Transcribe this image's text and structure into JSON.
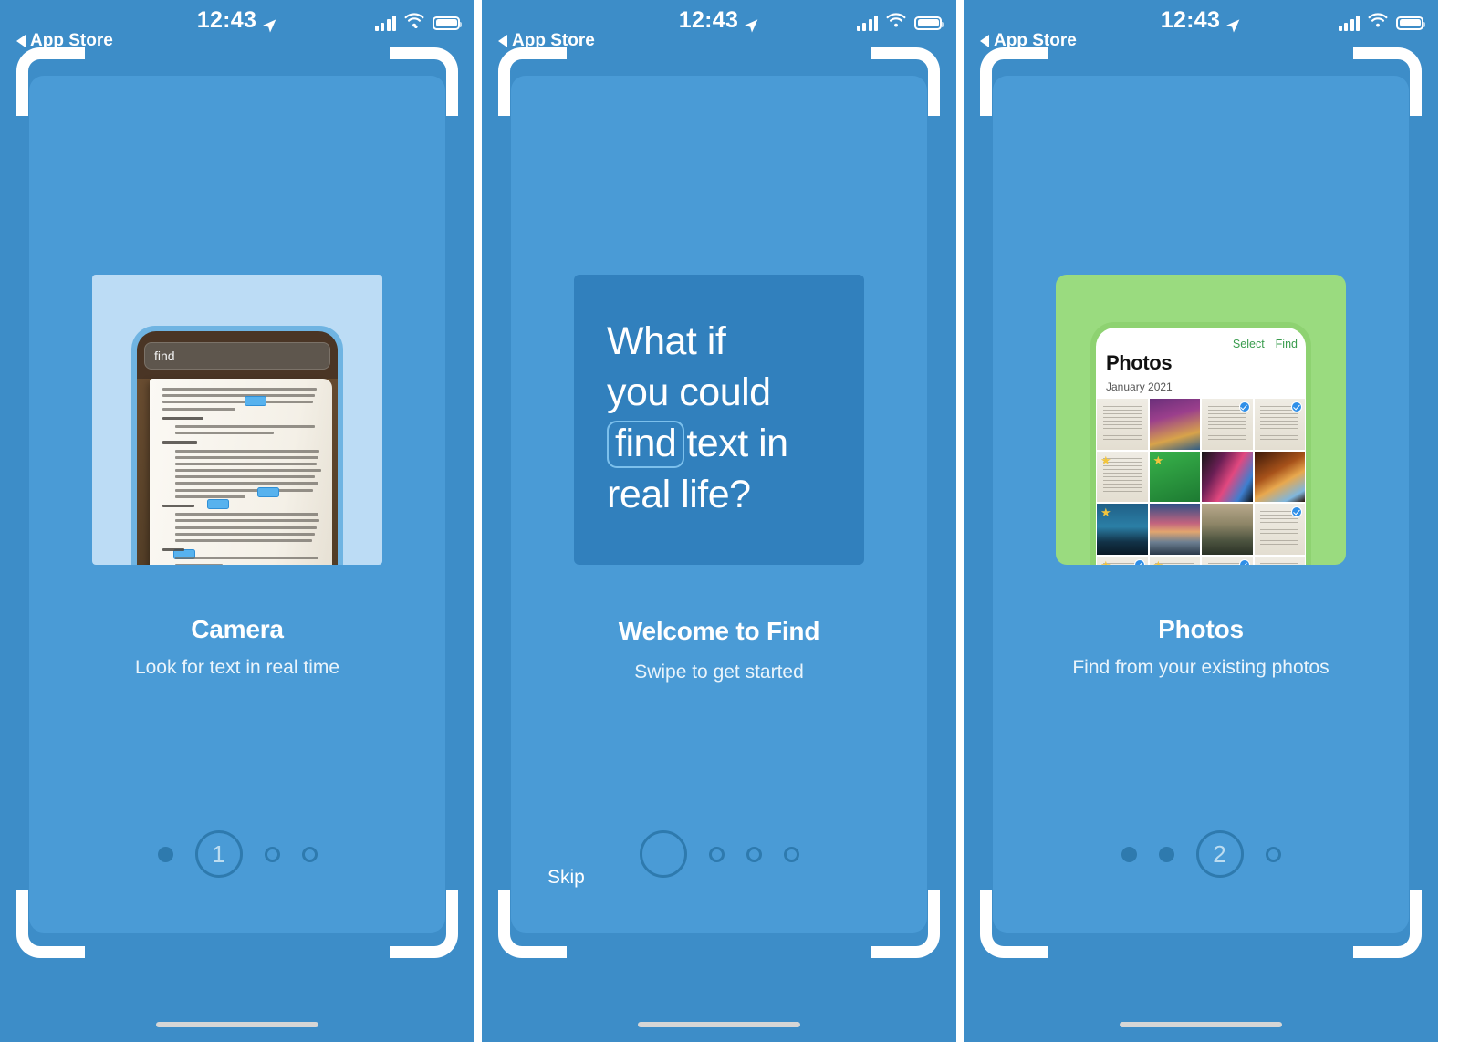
{
  "meta": {
    "accent_blue": "#4a9bd6",
    "panel_bg": "#3d8dc8",
    "dot_color": "#2e7aae",
    "quote_card_bg": "#3180bd",
    "photos_green": "#9adb7f",
    "camera_blue": "#bcdcf5"
  },
  "status_bar": {
    "time": "12:43",
    "back_label": "App Store",
    "location_icon": "location-arrow-icon",
    "signal_icon": "cellular-signal-icon",
    "wifi_icon": "wifi-icon",
    "battery_icon": "battery-icon"
  },
  "panels": [
    {
      "id": "camera",
      "caption_title": "Camera",
      "caption_subtitle": "Look for text in real time",
      "hero": {
        "kind": "phone-scanning-book",
        "search_value": "find",
        "backdrop_color": "#bcdcf5"
      },
      "pager": {
        "items": [
          {
            "type": "filled"
          },
          {
            "type": "current",
            "label": "1"
          },
          {
            "type": "hollow"
          },
          {
            "type": "hollow"
          }
        ]
      },
      "skip_label": null
    },
    {
      "id": "welcome",
      "caption_title": "Welcome to Find",
      "caption_subtitle": "Swipe to get started",
      "hero": {
        "kind": "quote-card",
        "backdrop_color": "#3180bd",
        "lines": [
          "What if",
          "you could",
          "",
          "real life?"
        ],
        "line3_pre": "",
        "highlight_word": "find",
        "line3_post": "text in"
      },
      "pager": {
        "items": [
          {
            "type": "current",
            "label": ""
          },
          {
            "type": "hollow"
          },
          {
            "type": "hollow"
          },
          {
            "type": "hollow"
          }
        ]
      },
      "skip_label": "Skip"
    },
    {
      "id": "photos",
      "caption_title": "Photos",
      "caption_subtitle": "Find from your existing photos",
      "hero": {
        "kind": "photos-app",
        "backdrop_color": "#9adb7f",
        "app_title": "Photos",
        "section_label": "January 2021",
        "action_select": "Select",
        "action_find": "Find"
      },
      "pager": {
        "items": [
          {
            "type": "filled"
          },
          {
            "type": "filled"
          },
          {
            "type": "current",
            "label": "2"
          },
          {
            "type": "hollow"
          }
        ]
      },
      "skip_label": null
    }
  ],
  "photo_grid": [
    {
      "style": "doc",
      "star": false,
      "check": false
    },
    {
      "style": "poster",
      "star": false,
      "check": false
    },
    {
      "style": "doc",
      "star": false,
      "check": true
    },
    {
      "style": "doc",
      "star": false,
      "check": true
    },
    {
      "style": "doc",
      "star": true,
      "check": false
    },
    {
      "style": "green",
      "star": true,
      "check": false
    },
    {
      "style": "neon",
      "star": false,
      "check": false
    },
    {
      "style": "canyon",
      "star": false,
      "check": false
    },
    {
      "style": "dusk",
      "star": true,
      "check": false
    },
    {
      "style": "peak",
      "star": false,
      "check": false
    },
    {
      "style": "ridge",
      "star": false,
      "check": false
    },
    {
      "style": "doc",
      "star": false,
      "check": true
    },
    {
      "style": "doc",
      "star": true,
      "check": true
    },
    {
      "style": "doc",
      "star": true,
      "check": false
    },
    {
      "style": "doc",
      "star": false,
      "check": true
    },
    {
      "style": "doc",
      "star": false,
      "check": false
    }
  ],
  "book_page": {
    "paragraphs": [
      {
        "header": false,
        "lines": 4,
        "indent": false
      },
      {
        "header": true,
        "lines": 2,
        "indent": true
      },
      {
        "header": true,
        "lines": 8,
        "indent": true
      },
      {
        "header": true,
        "lines": 5,
        "indent": true
      },
      {
        "header": true,
        "lines": 2,
        "indent": true
      },
      {
        "header": false,
        "lines": 3,
        "indent": false
      }
    ]
  }
}
